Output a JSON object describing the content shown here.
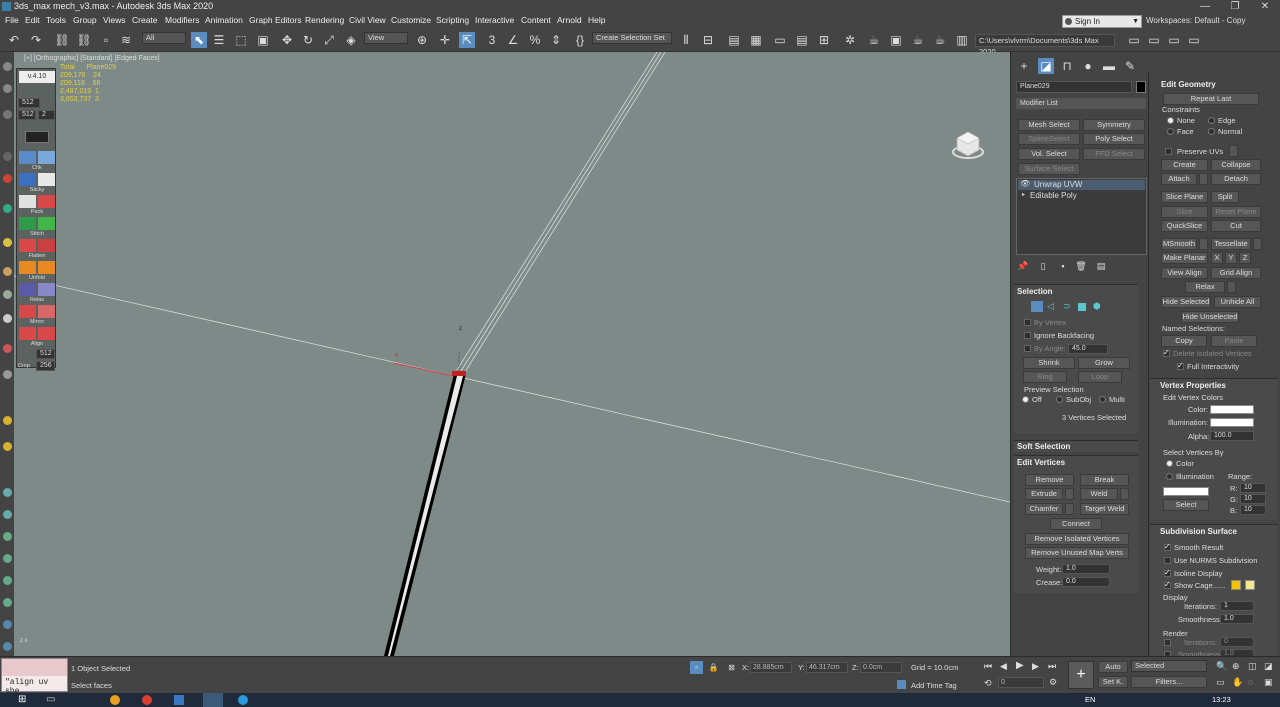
{
  "window": {
    "title": "3ds_max mech_v3.max - Autodesk 3ds Max 2020",
    "controls": [
      "—",
      "❐",
      "✕"
    ]
  },
  "menu": [
    "File",
    "Edit",
    "Tools",
    "Group",
    "Views",
    "Create",
    "Modifiers",
    "Animation",
    "Graph Editors",
    "Rendering",
    "Civil View",
    "Customize",
    "Scripting",
    "Interactive",
    "Content",
    "Arnold",
    "Help"
  ],
  "account": {
    "sign_in": "Sign In",
    "workspaces_label": "Workspaces:",
    "workspace_value": "Default - Copy"
  },
  "toolbar": {
    "filter_value": "All",
    "view_value": "View",
    "selection_set_placeholder": "Create Selection Set",
    "project_path": "C:\\Users\\vlvrm\\Documents\\3ds Max 2020"
  },
  "viewport": {
    "label": "[+] [Orthographic] [Standard] [Edged Faces]",
    "stats": [
      [
        "Total",
        "Plane029"
      ],
      [
        "209,176",
        "24"
      ],
      [
        "209,118",
        "56"
      ],
      [
        "2,487,019",
        "1"
      ],
      [
        "3,653,737",
        "3"
      ]
    ],
    "version": "v.4.10",
    "tool_fields": [
      "512",
      "512",
      "2"
    ],
    "tool_labels": [
      "Chk",
      "Sticky",
      "Pack",
      "Stitch",
      "Flatten",
      "Unfold",
      "Relax",
      "Mirror",
      "Align",
      "Crop",
      "Norm",
      "Tx"
    ],
    "tool_values": [
      "512",
      "256"
    ],
    "gizmo_labels": {
      "x": "x",
      "z": "z"
    },
    "axis_indicator": {
      "z": "z",
      "x": "x"
    }
  },
  "command_panel": {
    "object_name": "Plane029",
    "object_color": "#000000",
    "modifier_list": "Modifier List",
    "modifier_buttons": [
      {
        "label": "Mesh Select",
        "enabled": true
      },
      {
        "label": "Symmetry",
        "enabled": true
      },
      {
        "label": "SplineSelect",
        "enabled": false
      },
      {
        "label": "Poly Select",
        "enabled": true
      },
      {
        "label": "Vol. Select",
        "enabled": true
      },
      {
        "label": "FFD Select",
        "enabled": false
      },
      {
        "label": "Surface Select",
        "enabled": false
      }
    ],
    "stack": [
      "Unwrap UVW",
      "Editable Poly"
    ],
    "selection": {
      "title": "Selection",
      "by_vertex": "By Vertex",
      "ignore_backfacing": "Ignore Backfacing",
      "by_angle": "By Angle:",
      "angle_value": "45.0",
      "shrink": "Shrink",
      "grow": "Grow",
      "ring": "Ring",
      "loop": "Loop",
      "preview": "Preview Selection",
      "off": "Off",
      "subobj": "SubObj",
      "multi": "Multi",
      "status": "3 Vertices Selected"
    },
    "soft_selection": "Soft Selection",
    "edit_vertices": {
      "title": "Edit Vertices",
      "remove": "Remove",
      "break": "Break",
      "extrude": "Extrude",
      "weld": "Weld",
      "chamfer": "Chamfer",
      "target_weld": "Target Weld",
      "connect": "Connect",
      "remove_isolated": "Remove Isolated Vertices",
      "remove_unused": "Remove Unused Map Verts",
      "weight_label": "Weight:",
      "weight_value": "1.0",
      "crease_label": "Crease:",
      "crease_value": "0.0"
    }
  },
  "edit_geometry": {
    "title": "Edit Geometry",
    "repeat_last": "Repeat Last",
    "constraints": "Constraints",
    "none": "None",
    "edge": "Edge",
    "face": "Face",
    "normal": "Normal",
    "preserve_uvs": "Preserve UVs",
    "create": "Create",
    "collapse": "Collapse",
    "attach": "Attach",
    "detach": "Detach",
    "slice_plane": "Slice Plane",
    "split": "Split",
    "slice": "Slice",
    "reset_plane": "Reset Plane",
    "quickslice": "QuickSlice",
    "cut": "Cut",
    "msmooth": "MSmooth",
    "tessellate": "Tessellate",
    "make_planar": "Make Planar",
    "x": "X",
    "y": "Y",
    "z": "Z",
    "view_align": "View Align",
    "grid_align": "Grid Align",
    "relax": "Relax",
    "hide_selected": "Hide Selected",
    "unhide_all": "Unhide All",
    "hide_unselected": "Hide Unselected",
    "named_selections": "Named Selections:",
    "copy": "Copy",
    "paste": "Paste",
    "delete_isolated": "Delete Isolated Vertices",
    "full_interactivity": "Full Interactivity"
  },
  "vertex_properties": {
    "title": "Vertex Properties",
    "edit_colors": "Edit Vertex Colors",
    "color": "Color:",
    "illumination": "Illumination:",
    "alpha": "Alpha:",
    "alpha_value": "100.0",
    "select_by": "Select Vertices By",
    "by_color": "Color",
    "by_illum": "Illumination",
    "range": "Range:",
    "r": "R:",
    "g": "G:",
    "b": "B:",
    "rv": "10",
    "gv": "10",
    "bv": "10",
    "select": "Select"
  },
  "subdivision": {
    "title": "Subdivision Surface",
    "smooth_result": "Smooth Result",
    "use_nurms": "Use NURMS Subdivision",
    "isoline": "Isoline Display",
    "show_cage": "Show Cage......",
    "cage_colors": [
      "#f2c200",
      "#f2e890"
    ],
    "display": "Display",
    "iterations": "Iterations:",
    "iter_value": "1",
    "smoothness": "Smoothness:",
    "smooth_value": "1.0",
    "render": "Render",
    "r_iterations": "Iterations:",
    "r_iter_value": "0",
    "r_smoothness": "Smoothness:",
    "r_smooth_value": "1.0"
  },
  "status": {
    "maxscript": "\"align uv she",
    "selected": "1 Object Selected",
    "prompt": "Select faces",
    "x_label": "X:",
    "x_value": "28.885cm",
    "y_label": "Y:",
    "y_value": "46.317cm",
    "z_label": "Z:",
    "z_value": "0.0cm",
    "grid": "Grid = 10.0cm",
    "add_time_tag": "Add Time Tag",
    "frame": "0",
    "auto": "Auto",
    "setk": "Set K.",
    "key_filter": "Selected",
    "filters": "Filters..."
  },
  "taskbar": {
    "lang": "EN",
    "time": "13:23"
  }
}
